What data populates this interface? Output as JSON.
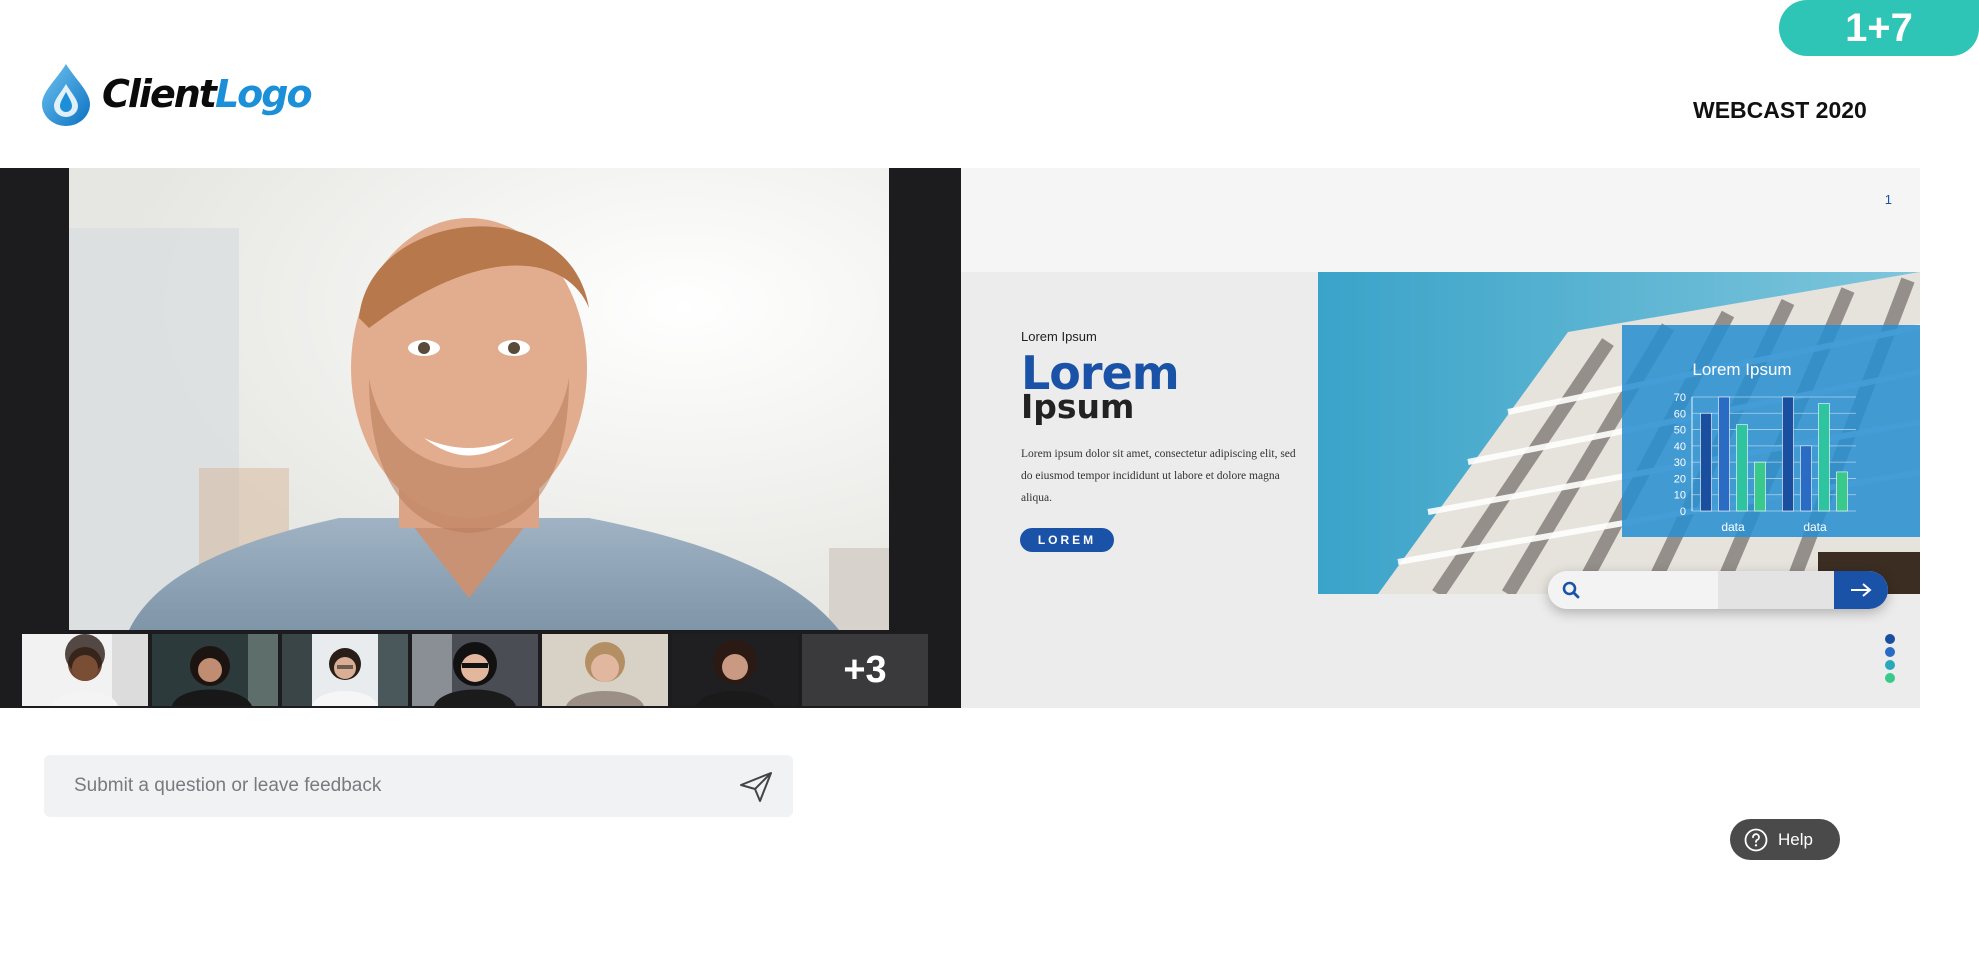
{
  "header": {
    "logo_text_dark": "Client",
    "logo_text_blue": "Logo",
    "participant_count": "1+7",
    "event_title": "WEBCAST 2020"
  },
  "video": {
    "extra_participants": "+3",
    "thumbnail_count": 6
  },
  "slide": {
    "page_number": "1",
    "eyebrow": "Lorem Ipsum",
    "headline": "Lorem",
    "subheadline": "Ipsum",
    "body": "Lorem ipsum dolor sit amet, consectetur adipiscing elit, sed do eiusmod tempor incididunt ut labore et dolore magna aliqua.",
    "button_label": "LOREM",
    "colors": {
      "primary": "#1a52a8",
      "accent": "#2ec4b6",
      "chart_panel": "#2a8fd0"
    },
    "icons": [
      "search-icon",
      "arrow-right-icon"
    ],
    "pager_dots": 4
  },
  "chart_data": {
    "type": "bar",
    "title": "Lorem Ipsum",
    "categories": [
      "data",
      "data"
    ],
    "series": [
      {
        "values": [
          60,
          70
        ]
      },
      {
        "values": [
          70,
          40
        ]
      },
      {
        "values": [
          53,
          66
        ]
      },
      {
        "values": [
          30,
          24
        ]
      }
    ],
    "ylim": [
      0,
      70
    ],
    "yticks": [
      0,
      10,
      20,
      30,
      40,
      50,
      60,
      70
    ],
    "grid": true,
    "colors": [
      "#1a4fa0",
      "#2a6cc4",
      "#2ec4a0",
      "#39c98a"
    ]
  },
  "question": {
    "placeholder": "Submit a question or leave feedback",
    "value": ""
  },
  "help": {
    "label": "Help"
  }
}
